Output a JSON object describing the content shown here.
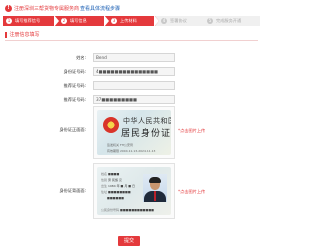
{
  "notice": {
    "text": "注册深圳三帮货物专属服务商",
    "link": "查看具体流程步骤"
  },
  "steps": [
    {
      "num": "1",
      "label": "填写推荐信号",
      "active": true
    },
    {
      "num": "2",
      "label": "填写信息",
      "active": true
    },
    {
      "num": "3",
      "label": "上传材料",
      "active": true
    },
    {
      "num": "4",
      "label": "签署协议",
      "active": false
    },
    {
      "num": "5",
      "label": "完成服务开通",
      "active": false
    }
  ],
  "section_title": "注册信息填写",
  "form": {
    "name": {
      "label": "姓名:",
      "value": "Bend"
    },
    "id_number": {
      "label": "身份证号码:",
      "value": "4■■■■■■■■■■■■■■■"
    },
    "phone": {
      "label": "推荐证号码:",
      "value": ""
    },
    "agent_number": {
      "label": "推荐证号码:",
      "value": "37■■■■■■■■■"
    }
  },
  "front_upload": {
    "label": "身份证正面面:",
    "hint": "*点击图片上传",
    "card_title": "中华人民共和国",
    "card_sub": "居民身份证",
    "authority_label": "签发机关",
    "authority_value": "FH公安局",
    "valid_label": "有效期限",
    "valid_value": "2004.11.13-2024.11.13"
  },
  "back_upload": {
    "label": "身份证背面面:",
    "hint": "*点击图片上传",
    "fields": [
      {
        "k": "姓名",
        "v": "■■■■"
      },
      {
        "k": "性别",
        "v": "男  民族 汉"
      },
      {
        "k": "出生",
        "v": "1984 年 ■ 月 ■ 日"
      },
      {
        "k": "住址",
        "v": "■■■■■■■■"
      },
      {
        "k": "",
        "v": "■■■■■■"
      },
      {
        "k": "公民身份号码",
        "v": "■■■■■■■■■■■■"
      }
    ]
  },
  "submit_label": "提交",
  "colors": {
    "accent": "#e4393c",
    "link": "#1a5fb4"
  }
}
